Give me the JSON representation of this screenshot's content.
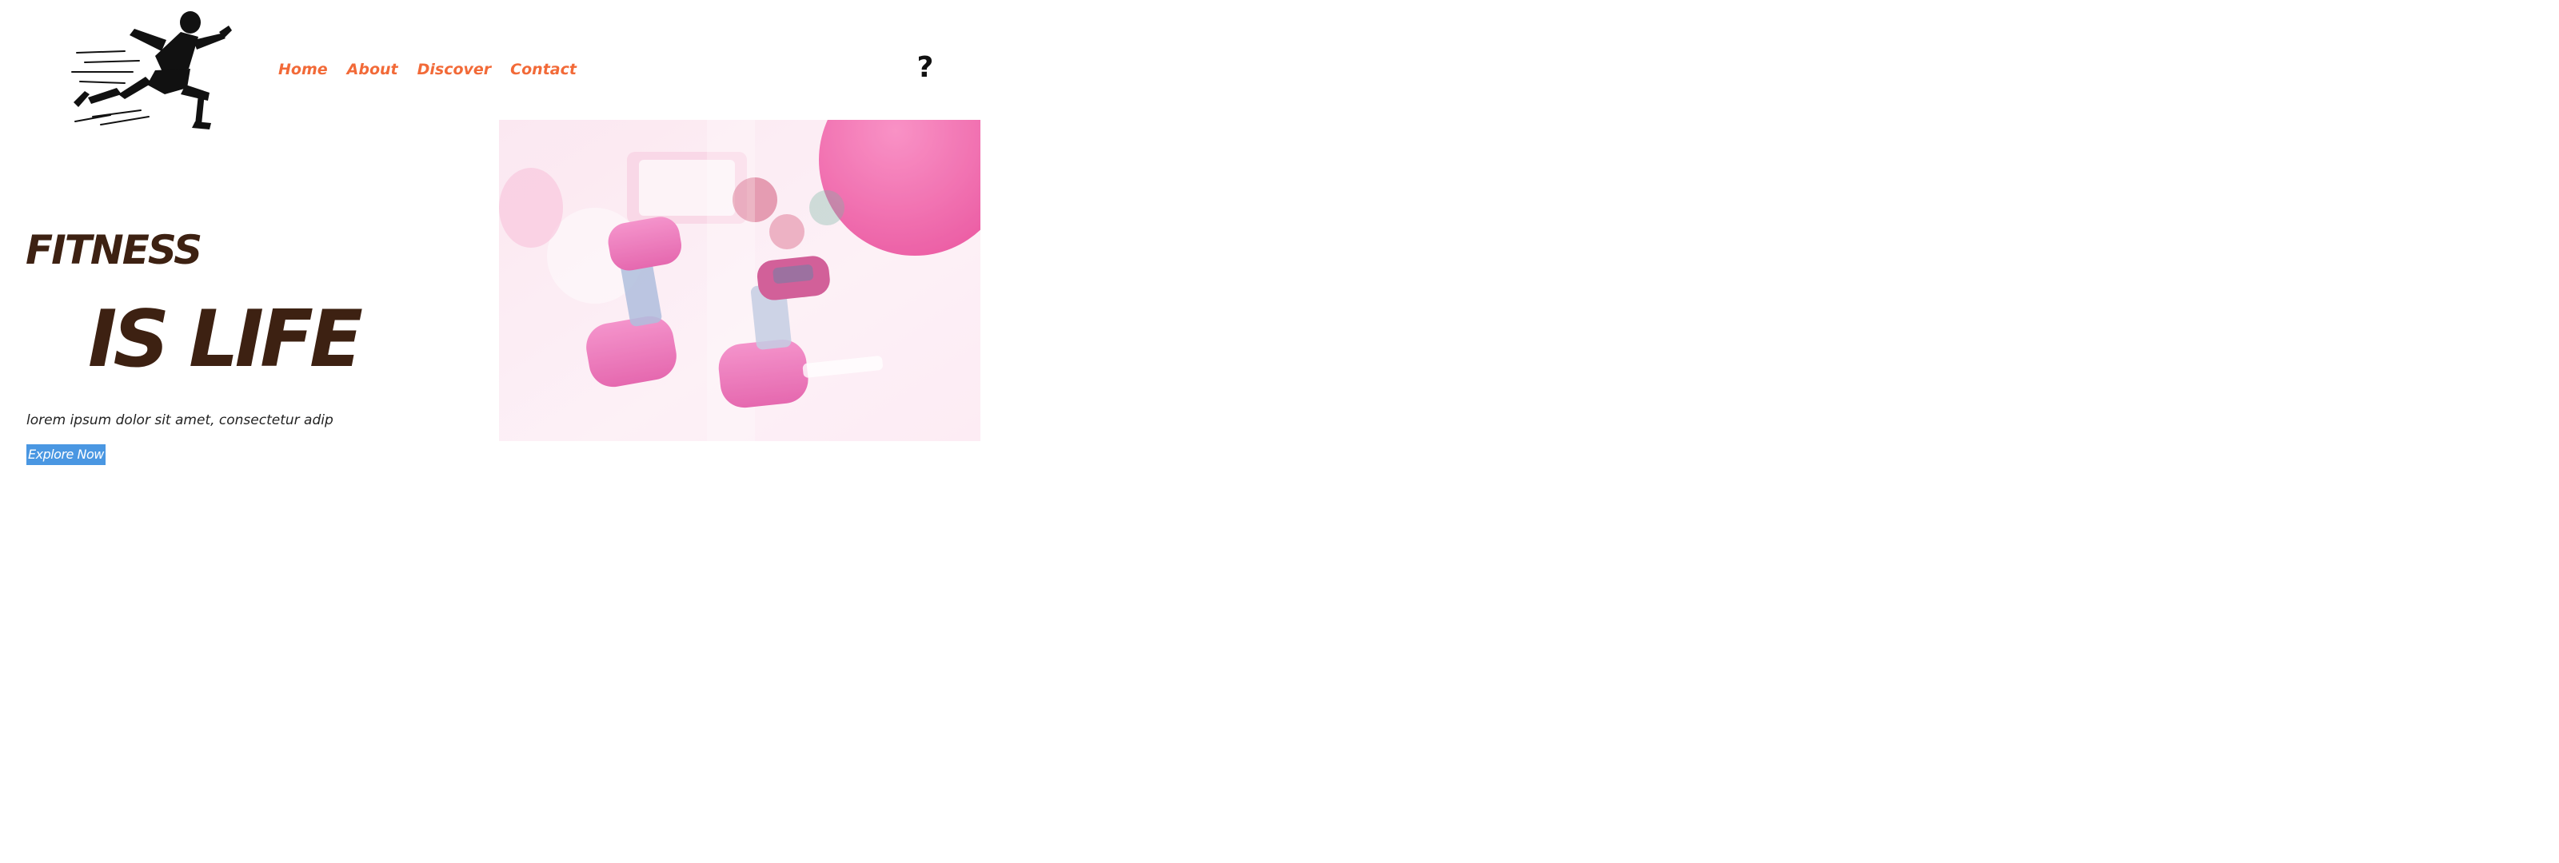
{
  "header": {
    "logo_icon": "sprinter-logo-icon",
    "nav": [
      {
        "label": "Home"
      },
      {
        "label": "About"
      },
      {
        "label": "Discover"
      },
      {
        "label": "Contact"
      }
    ],
    "help_label": "?"
  },
  "hero": {
    "line1": "FITNESS",
    "line2": "IS LIFE",
    "subtitle": "lorem ipsum dolor sit amet, consectetur adip",
    "cta_label": "Explore Now",
    "image_icon": "pink-dumbbells-photo"
  },
  "colors": {
    "nav_accent": "#f26a38",
    "heading": "#3d2112",
    "button_bg": "#4a97e2",
    "photo_pink": "#e8449c"
  }
}
